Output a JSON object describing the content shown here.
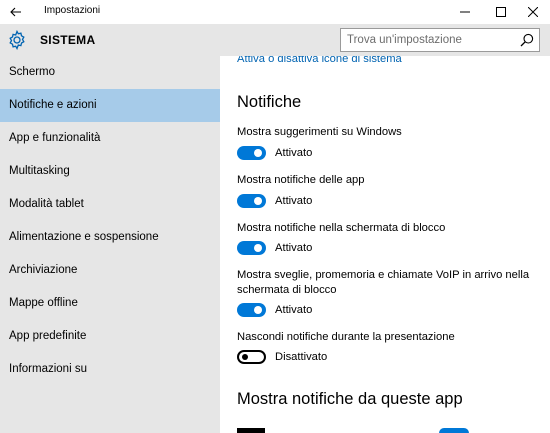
{
  "window": {
    "title": "Impostazioni"
  },
  "header": {
    "title": "SISTEMA"
  },
  "search": {
    "placeholder": "Trova un'impostazione"
  },
  "sidebar": {
    "items": [
      {
        "label": "Schermo",
        "active": false
      },
      {
        "label": "Notifiche e azioni",
        "active": true
      },
      {
        "label": "App e funzionalità",
        "active": false
      },
      {
        "label": "Multitasking",
        "active": false
      },
      {
        "label": "Modalità tablet",
        "active": false
      },
      {
        "label": "Alimentazione e sospensione",
        "active": false
      },
      {
        "label": "Archiviazione",
        "active": false
      },
      {
        "label": "Mappe offline",
        "active": false
      },
      {
        "label": "App predefinite",
        "active": false
      },
      {
        "label": "Informazioni su",
        "active": false
      }
    ]
  },
  "main": {
    "link": "Attiva o disattiva icone di sistema",
    "section_title": "Notifiche",
    "settings": [
      {
        "label": "Mostra suggerimenti su Windows",
        "state": "Attivato",
        "on": true
      },
      {
        "label": "Mostra notifiche delle app",
        "state": "Attivato",
        "on": true
      },
      {
        "label": "Mostra notifiche nella schermata di blocco",
        "state": "Attivato",
        "on": true
      },
      {
        "label": "Mostra sveglie, promemoria e chiamate VoIP in arrivo nella schermata di blocco",
        "state": "Attivato",
        "on": true
      },
      {
        "label": "Nascondi notifiche durante la presentazione",
        "state": "Disattivato",
        "on": false
      }
    ],
    "apps_title": "Mostra notifiche da queste app"
  },
  "colors": {
    "accent": "#0078d7",
    "link": "#0063b1",
    "sidebar_bg": "#e6e6e6",
    "active_item": "#a6cbe9"
  }
}
